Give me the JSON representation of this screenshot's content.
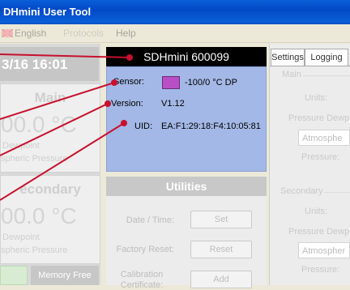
{
  "window": {
    "title": "DHmini User Tool"
  },
  "menu": {
    "english": "English",
    "disabled_item": "Protocols",
    "help": "Help"
  },
  "left": {
    "datetime": "3/16   16:01",
    "main": {
      "title": "Main",
      "value": "00.0 °C",
      "line1": "Dewpoint",
      "line2": "spheric Pressure"
    },
    "secondary": {
      "title": "econdary",
      "value": "00.0 °C",
      "line1": "Dewpoint",
      "line2": "spheric Pressure"
    },
    "memory_label": "Memory Free"
  },
  "device": {
    "header": "SDHmini 600099",
    "sensor_label": "Sensor:",
    "sensor_value": "-100/0 °C DP",
    "sensor_color": "#b84fc4",
    "version_label": "Version:",
    "version_value": "V1.12",
    "uid_label": "UID:",
    "uid_value": "EA:F1:29:18:F4:10:05:81"
  },
  "utilities": {
    "title": "Utilities",
    "date_label": "Date / Time:",
    "date_button": "Set",
    "reset_label": "Factory Reset:",
    "reset_button": "Reset",
    "cal_label1": "Calibration",
    "cal_label2": "Certificate:",
    "cal_button": "Add"
  },
  "right": {
    "tabs": [
      "Settings",
      "Logging"
    ],
    "main_group": "Main",
    "units_label": "Units:",
    "pressure_group": "Pressure Dewp",
    "atmos_value": "Atmosphe",
    "pressure_label": "Pressure:",
    "secondary_group": "Secondary",
    "units_label2": "Units:",
    "pressure_group2": "Pressure Dewp",
    "atmos_value2": "Atmospher",
    "pressure_label2": "Pressure:"
  },
  "colors": {
    "annotation": "#c8102e",
    "titlebar": "#0a5fd8"
  }
}
